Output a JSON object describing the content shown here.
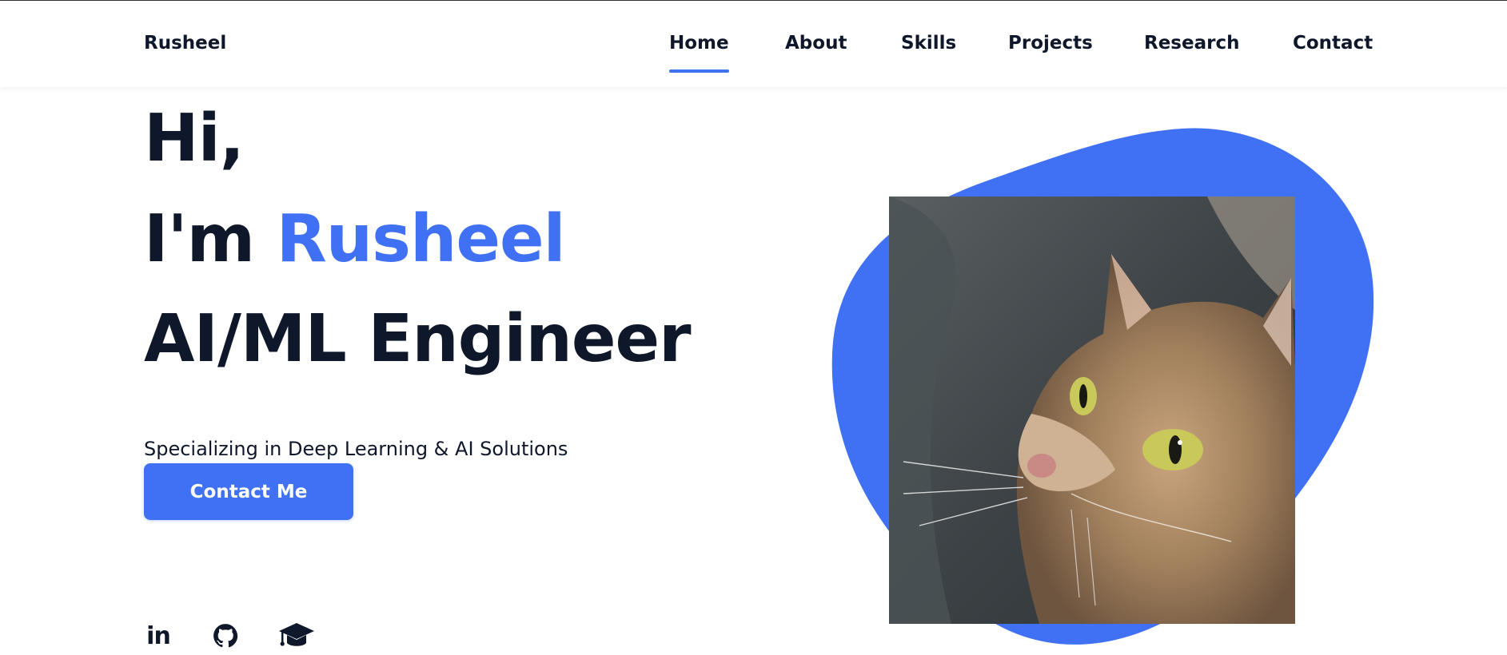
{
  "header": {
    "logo": "Rusheel",
    "nav": [
      {
        "label": "Home",
        "active": true
      },
      {
        "label": "About",
        "active": false
      },
      {
        "label": "Skills",
        "active": false
      },
      {
        "label": "Projects",
        "active": false
      },
      {
        "label": "Research",
        "active": false
      },
      {
        "label": "Contact",
        "active": false
      }
    ]
  },
  "hero": {
    "greeting": "Hi,",
    "intro_prefix": "I'm",
    "name": "Rusheel",
    "role": "AI/ML Engineer",
    "subtitle": "Specializing in Deep Learning & AI Solutions",
    "cta_label": "Contact Me"
  },
  "social": {
    "linkedin_text": "in",
    "icons": [
      "linkedin-icon",
      "github-icon",
      "graduation-cap-icon"
    ]
  },
  "colors": {
    "accent": "#4070f4",
    "text": "#0f172a",
    "background": "#ffffff"
  }
}
